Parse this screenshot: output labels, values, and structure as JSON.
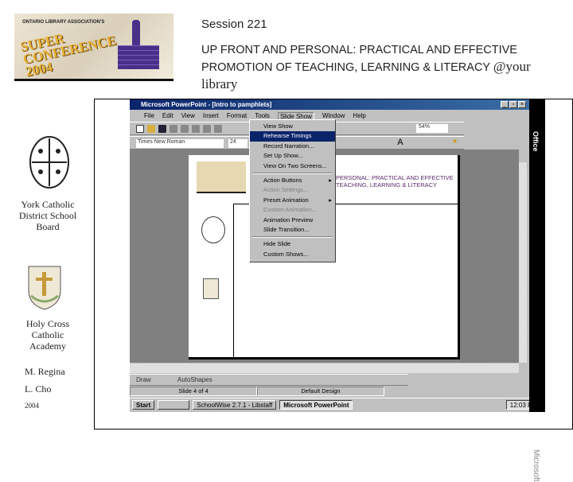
{
  "header": {
    "session": "Session 221",
    "title_line1": "UP FRONT AND PERSONAL: PRACTICAL AND EFFECTIVE",
    "title_line2": "PROMOTION OF TEACHING, LEARNING & LITERACY",
    "title_tail": "@your",
    "title_line3": "library"
  },
  "logo": {
    "org": "ONTARIO LIBRARY ASSOCIATION'S",
    "name": "SUPER CONFERENCE 2004"
  },
  "sidebar": {
    "board": "York Catholic District School Board",
    "school": "Holy Cross Catholic Academy",
    "author1": "M. Regina",
    "author2": "L. Cho",
    "year": "2004"
  },
  "window": {
    "title": "Microsoft PowerPoint - [Intro to pamphlets]",
    "menus": [
      "File",
      "Edit",
      "View",
      "Insert",
      "Format",
      "Tools",
      "Slide Show",
      "Window",
      "Help"
    ],
    "font_name": "Times New Roman",
    "font_size": "24",
    "zoom": "54%"
  },
  "slideshow_menu": [
    {
      "label": "View Show",
      "state": "normal"
    },
    {
      "label": "Rehearse Timings",
      "state": "selected"
    },
    {
      "label": "Record Narration...",
      "state": "normal"
    },
    {
      "label": "Set Up Show...",
      "state": "normal"
    },
    {
      "label": "View On Two Screens...",
      "state": "normal"
    },
    {
      "sep": true
    },
    {
      "label": "Action Buttons",
      "state": "normal",
      "submenu": true
    },
    {
      "label": "Action Settings...",
      "state": "disabled"
    },
    {
      "label": "Preset Animation",
      "state": "normal",
      "submenu": true
    },
    {
      "label": "Custom Animation...",
      "state": "disabled"
    },
    {
      "label": "Animation Preview",
      "state": "normal"
    },
    {
      "label": "Slide Transition...",
      "state": "normal"
    },
    {
      "sep": true
    },
    {
      "label": "Hide Slide",
      "state": "normal"
    },
    {
      "label": "Custom Shows...",
      "state": "normal"
    }
  ],
  "slide": {
    "title1": "PERSONAL: PRACTICAL AND EFFECTIVE",
    "title2": "TEACHING, LEARNING & LITERACY"
  },
  "drawing": {
    "draw": "Draw",
    "autoshapes": "AutoShapes"
  },
  "status": {
    "slide": "Slide 4 of 4",
    "design": "Default Design"
  },
  "taskbar": {
    "start": "Start",
    "task1": "SchoolWise 2.7.1 - Libstaff",
    "task2": "Microsoft PowerPoint",
    "clock": "12:03 PM"
  },
  "officebar": {
    "label": "Office",
    "brand": "Microsoft"
  }
}
